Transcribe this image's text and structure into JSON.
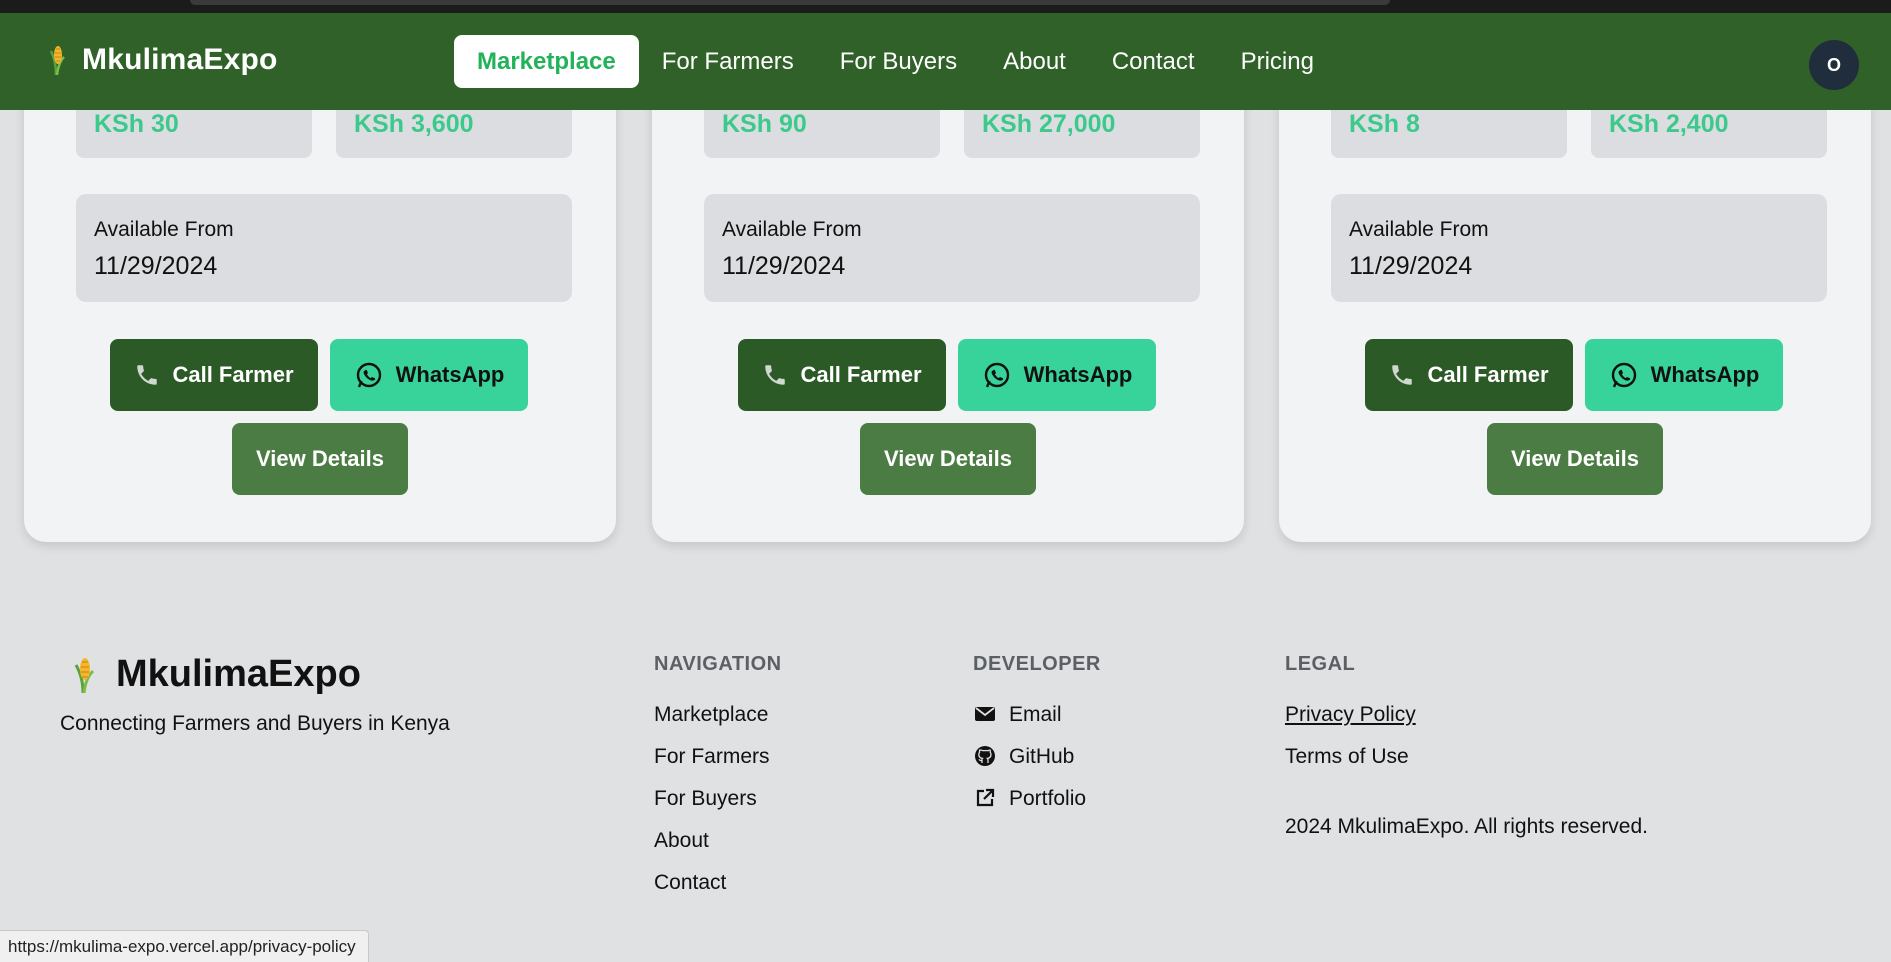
{
  "header": {
    "brand": "MkulimaExpo",
    "nav": [
      "Marketplace",
      "For Farmers",
      "For Buyers",
      "About",
      "Contact",
      "Pricing"
    ],
    "active_nav": "Marketplace",
    "avatar_initial": "O"
  },
  "cards": [
    {
      "price_per_unit": "KSh 30",
      "total_price": "KSh 3,600",
      "available_label": "Available From",
      "available_date": "11/29/2024",
      "call_label": "Call Farmer",
      "whatsapp_label": "WhatsApp",
      "details_label": "View Details"
    },
    {
      "price_per_unit": "KSh 90",
      "total_price": "KSh 27,000",
      "available_label": "Available From",
      "available_date": "11/29/2024",
      "call_label": "Call Farmer",
      "whatsapp_label": "WhatsApp",
      "details_label": "View Details"
    },
    {
      "price_per_unit": "KSh 8",
      "total_price": "KSh 2,400",
      "available_label": "Available From",
      "available_date": "11/29/2024",
      "call_label": "Call Farmer",
      "whatsapp_label": "WhatsApp",
      "details_label": "View Details"
    }
  ],
  "footer": {
    "brand": "MkulimaExpo",
    "tagline": "Connecting Farmers and Buyers in Kenya",
    "navigation": {
      "heading": "NAVIGATION",
      "links": [
        "Marketplace",
        "For Farmers",
        "For Buyers",
        "About",
        "Contact"
      ]
    },
    "developer": {
      "heading": "DEVELOPER",
      "links": [
        {
          "label": "Email",
          "icon": "envelope-icon"
        },
        {
          "label": "GitHub",
          "icon": "github-icon"
        },
        {
          "label": "Portfolio",
          "icon": "external-link-icon"
        }
      ]
    },
    "legal": {
      "heading": "LEGAL",
      "links": [
        "Privacy Policy",
        "Terms of Use"
      ]
    },
    "copyright": "2024 MkulimaExpo. All rights reserved."
  },
  "status_url": "https://mkulima-expo.vercel.app/privacy-policy",
  "colors": {
    "header_bg": "#2f6128",
    "active_nav_text": "#22b35a",
    "price_text": "#3cc98c",
    "call_button": "#2c5a26",
    "whatsapp_button": "#38d39a",
    "details_button": "#4b7c43",
    "page_bg": "#dfe1e3"
  }
}
